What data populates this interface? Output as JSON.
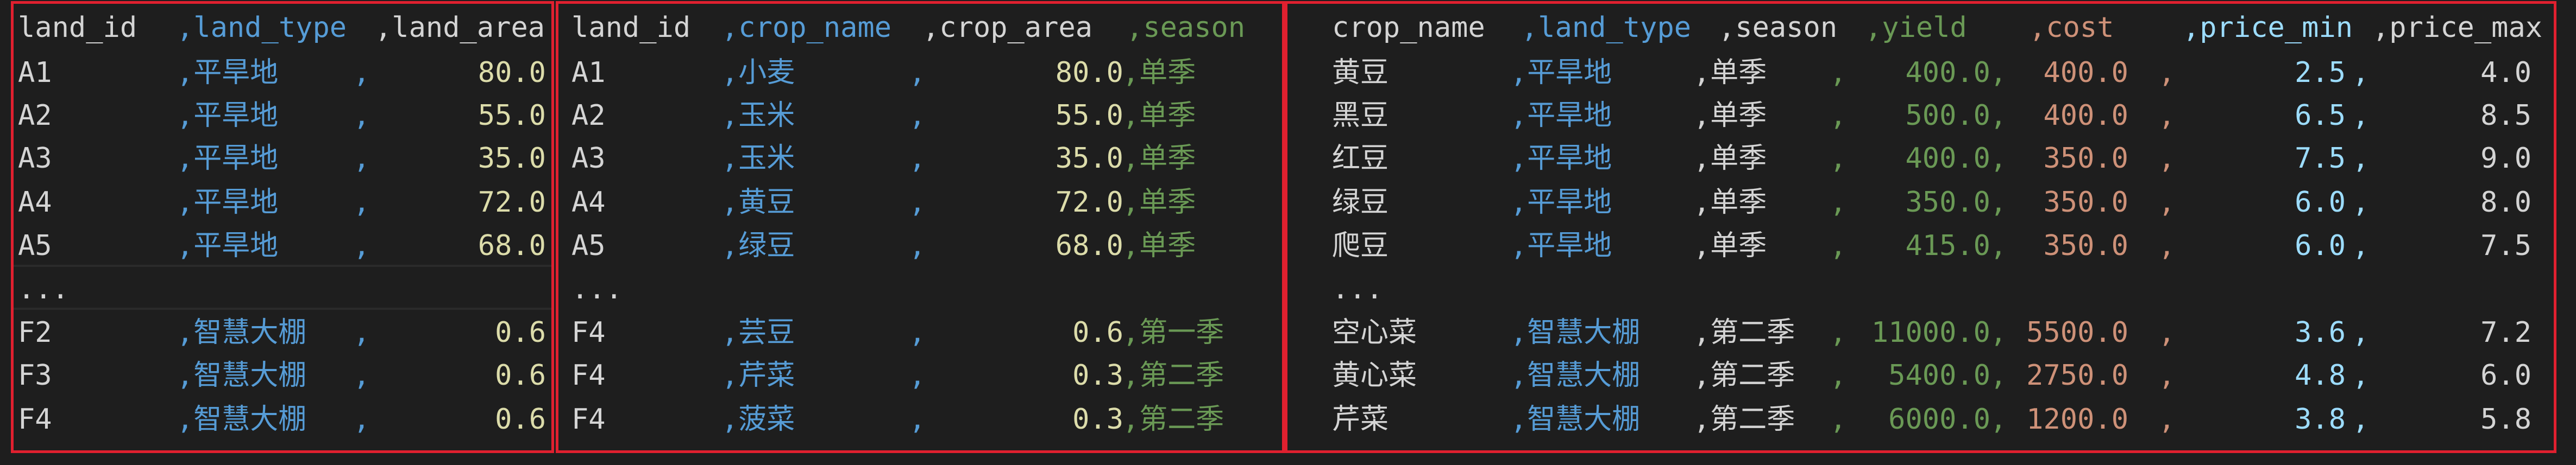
{
  "colors": {
    "border": "#e0202f",
    "background": "#1e1e1e",
    "text": "#d4d4d4",
    "blue": "#569cd6",
    "yellow": "#dcdcaa",
    "green": "#6a9955",
    "light_blue": "#9cdcfe",
    "orange": "#ce9178",
    "lime": "#b5cea8"
  },
  "table1": {
    "header": {
      "c1": "land_id",
      "c2": ",land_type",
      "c3": ",land_area"
    },
    "rows": [
      {
        "c1": "A1",
        "c2": ",平旱地",
        "c3": ",",
        "c4": "80.0"
      },
      {
        "c1": "A2",
        "c2": ",平旱地",
        "c3": ",",
        "c4": "55.0"
      },
      {
        "c1": "A3",
        "c2": ",平旱地",
        "c3": ",",
        "c4": "35.0"
      },
      {
        "c1": "A4",
        "c2": ",平旱地",
        "c3": ",",
        "c4": "72.0"
      },
      {
        "c1": "A5",
        "c2": ",平旱地",
        "c3": ",",
        "c4": "68.0"
      },
      {
        "c1": "...",
        "c2": "",
        "c3": "",
        "c4": ""
      },
      {
        "c1": "F2",
        "c2": ",智慧大棚",
        "c3": ",",
        "c4": "0.6"
      },
      {
        "c1": "F3",
        "c2": ",智慧大棚",
        "c3": ",",
        "c4": "0.6"
      },
      {
        "c1": "F4",
        "c2": ",智慧大棚",
        "c3": ",",
        "c4": "0.6"
      }
    ]
  },
  "table2": {
    "header": {
      "c1": "land_id",
      "c2": ",crop_name",
      "c3": ",crop_area",
      "c4": ",season"
    },
    "rows": [
      {
        "c1": "A1",
        "c2": ",小麦",
        "c3": ",",
        "c4": "80.0",
        "c5": ",单季"
      },
      {
        "c1": "A2",
        "c2": ",玉米",
        "c3": ",",
        "c4": "55.0",
        "c5": ",单季"
      },
      {
        "c1": "A3",
        "c2": ",玉米",
        "c3": ",",
        "c4": "35.0",
        "c5": ",单季"
      },
      {
        "c1": "A4",
        "c2": ",黄豆",
        "c3": ",",
        "c4": "72.0",
        "c5": ",单季"
      },
      {
        "c1": "A5",
        "c2": ",绿豆",
        "c3": ",",
        "c4": "68.0",
        "c5": ",单季"
      },
      {
        "c1": "...",
        "c2": "",
        "c3": "",
        "c4": "",
        "c5": ""
      },
      {
        "c1": "F4",
        "c2": ",芸豆",
        "c3": ",",
        "c4": "0.6",
        "c5": ",第一季"
      },
      {
        "c1": "F4",
        "c2": ",芹菜",
        "c3": ",",
        "c4": "0.3",
        "c5": ",第二季"
      },
      {
        "c1": "F4",
        "c2": ",菠菜",
        "c3": ",",
        "c4": "0.3",
        "c5": ",第二季"
      }
    ]
  },
  "table3": {
    "header": {
      "c1": "crop_name",
      "c2": ",land_type",
      "c3": ",season",
      "c4": ",yield",
      "c5": ",cost",
      "c6": ",price_min",
      "c7": ",price_max"
    },
    "rows": [
      {
        "c1": "黄豆",
        "c2": ",平旱地",
        "c3": ",单季",
        "c4": ",",
        "c5": "400.0",
        "c6": ",",
        "c7": "400.0",
        "c8": ",",
        "c9": "2.5",
        "c10": ",",
        "c11": "4.0"
      },
      {
        "c1": "黑豆",
        "c2": ",平旱地",
        "c3": ",单季",
        "c4": ",",
        "c5": "500.0",
        "c6": ",",
        "c7": "400.0",
        "c8": ",",
        "c9": "6.5",
        "c10": ",",
        "c11": "8.5"
      },
      {
        "c1": "红豆",
        "c2": ",平旱地",
        "c3": ",单季",
        "c4": ",",
        "c5": "400.0",
        "c6": ",",
        "c7": "350.0",
        "c8": ",",
        "c9": "7.5",
        "c10": ",",
        "c11": "9.0"
      },
      {
        "c1": "绿豆",
        "c2": ",平旱地",
        "c3": ",单季",
        "c4": ",",
        "c5": "350.0",
        "c6": ",",
        "c7": "350.0",
        "c8": ",",
        "c9": "6.0",
        "c10": ",",
        "c11": "8.0"
      },
      {
        "c1": "爬豆",
        "c2": ",平旱地",
        "c3": ",单季",
        "c4": ",",
        "c5": "415.0",
        "c6": ",",
        "c7": "350.0",
        "c8": ",",
        "c9": "6.0",
        "c10": ",",
        "c11": "7.5"
      },
      {
        "c1": "...",
        "c2": "",
        "c3": "",
        "c4": "",
        "c5": "",
        "c6": "",
        "c7": "",
        "c8": "",
        "c9": "",
        "c10": "",
        "c11": ""
      },
      {
        "c1": "空心菜",
        "c2": ",智慧大棚",
        "c3": ",第二季",
        "c4": ",",
        "c5": "11000.0",
        "c6": ",",
        "c7": "5500.0",
        "c8": ",",
        "c9": "3.6",
        "c10": ",",
        "c11": "7.2"
      },
      {
        "c1": "黄心菜",
        "c2": ",智慧大棚",
        "c3": ",第二季",
        "c4": ",",
        "c5": "5400.0",
        "c6": ",",
        "c7": "2750.0",
        "c8": ",",
        "c9": "4.8",
        "c10": ",",
        "c11": "6.0"
      },
      {
        "c1": "芹菜",
        "c2": ",智慧大棚",
        "c3": ",第二季",
        "c4": ",",
        "c5": "6000.0",
        "c6": ",",
        "c7": "1200.0",
        "c8": ",",
        "c9": "3.8",
        "c10": ",",
        "c11": "5.8"
      }
    ]
  }
}
